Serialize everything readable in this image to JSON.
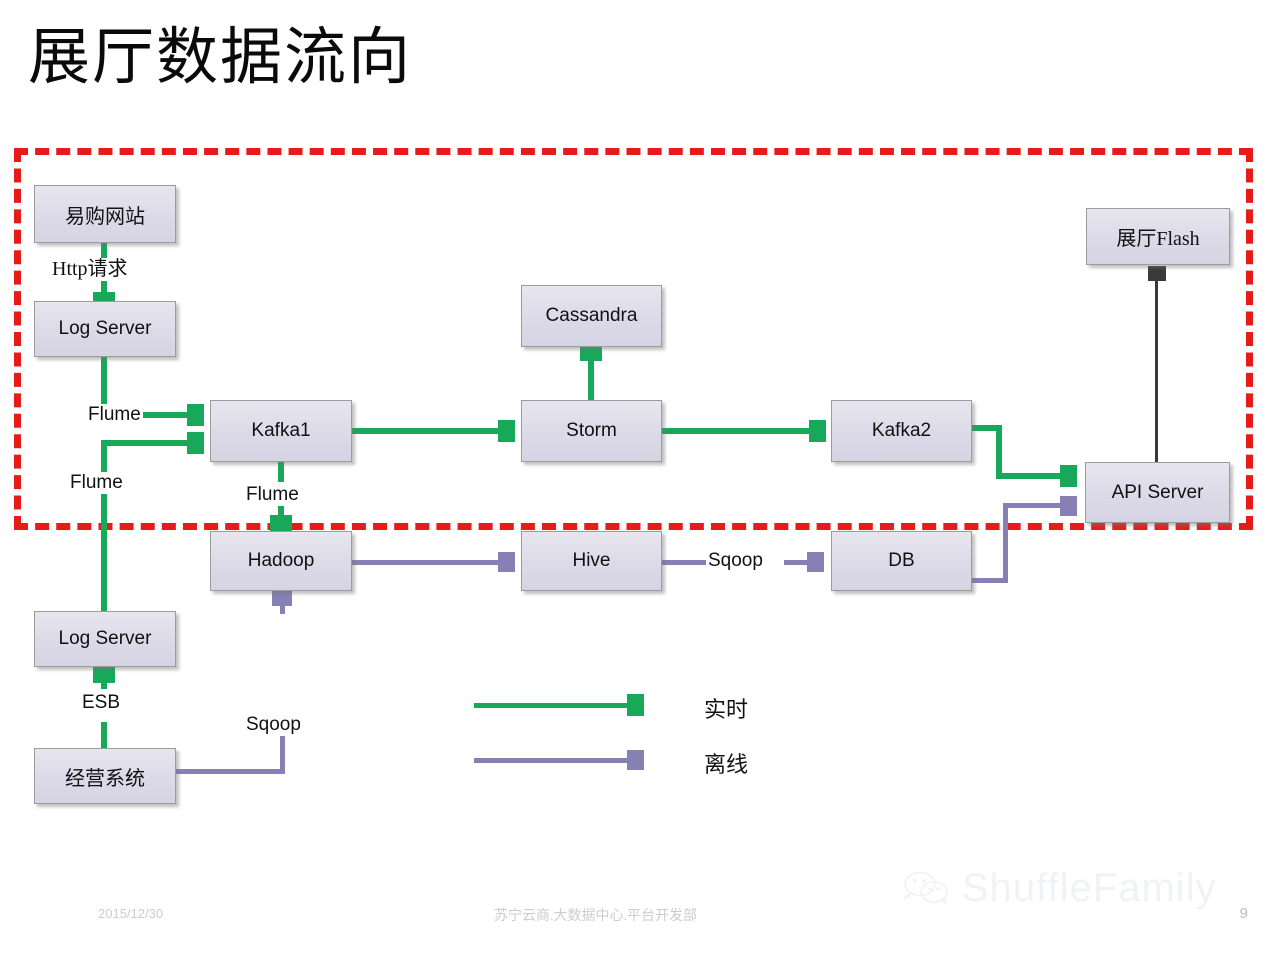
{
  "slide": {
    "title": "展厅数据流向",
    "page_number": "9"
  },
  "zone": {
    "name": "realtime-zone",
    "border_color": "#e81b1b",
    "style": "dashed"
  },
  "nodes": [
    {
      "id": "yigou",
      "label": "易购网站"
    },
    {
      "id": "log-server-1",
      "label": "Log Server"
    },
    {
      "id": "kafka1",
      "label": "Kafka1"
    },
    {
      "id": "cassandra",
      "label": "Cassandra"
    },
    {
      "id": "storm",
      "label": "Storm"
    },
    {
      "id": "kafka2",
      "label": "Kafka2"
    },
    {
      "id": "flash",
      "label": "展厅Flash"
    },
    {
      "id": "api-server",
      "label": "API Server"
    },
    {
      "id": "hadoop",
      "label": "Hadoop"
    },
    {
      "id": "hive",
      "label": "Hive"
    },
    {
      "id": "db",
      "label": "DB"
    },
    {
      "id": "log-server-2",
      "label": "Log Server"
    },
    {
      "id": "jingying",
      "label": "经营系统"
    }
  ],
  "edge_labels": {
    "http_request": "Http请求",
    "flume_1": "Flume",
    "flume_2": "Flume",
    "flume_3": "Flume",
    "esb": "ESB",
    "sqoop_1": "Sqoop",
    "sqoop_2": "Sqoop"
  },
  "legend": {
    "items": [
      {
        "label": "实时",
        "color": "#17a85a"
      },
      {
        "label": "离线",
        "color": "#8680b4"
      }
    ]
  },
  "footer": {
    "date": "2015/12/30",
    "org": "苏宁云商.大数据中心.平台开发部"
  },
  "watermark": {
    "text": "ShuffleFamily",
    "icon": "wechat-icon"
  },
  "chart_data": {
    "type": "diagram",
    "title": "展厅数据流向",
    "nodes": [
      "易购网站",
      "Log Server",
      "Kafka1",
      "Cassandra",
      "Storm",
      "Kafka2",
      "展厅Flash",
      "API Server",
      "Hadoop",
      "Hive",
      "DB",
      "Log Server",
      "经营系统"
    ],
    "edges": [
      {
        "from": "易购网站",
        "to": "Log Server (top)",
        "label": "Http请求",
        "kind": "realtime"
      },
      {
        "from": "Log Server (top)",
        "to": "Kafka1",
        "label": "Flume",
        "kind": "realtime"
      },
      {
        "from": "Log Server (bottom)",
        "to": "Kafka1",
        "label": "Flume",
        "kind": "realtime"
      },
      {
        "from": "Kafka1",
        "to": "Hadoop",
        "label": "Flume",
        "kind": "realtime"
      },
      {
        "from": "Kafka1",
        "to": "Storm",
        "label": "",
        "kind": "realtime"
      },
      {
        "from": "Storm",
        "to": "Cassandra",
        "label": "",
        "kind": "realtime"
      },
      {
        "from": "Storm",
        "to": "Kafka2",
        "label": "",
        "kind": "realtime"
      },
      {
        "from": "Kafka2",
        "to": "API Server",
        "label": "",
        "kind": "realtime"
      },
      {
        "from": "API Server",
        "to": "展厅Flash",
        "label": "",
        "kind": "serve"
      },
      {
        "from": "经营系统",
        "to": "Log Server (bottom)",
        "label": "ESB",
        "kind": "realtime"
      },
      {
        "from": "经营系统",
        "to": "Hadoop",
        "label": "Sqoop",
        "kind": "offline"
      },
      {
        "from": "Hadoop",
        "to": "Hive",
        "label": "",
        "kind": "offline"
      },
      {
        "from": "Hive",
        "to": "DB",
        "label": "Sqoop",
        "kind": "offline"
      },
      {
        "from": "DB",
        "to": "API Server",
        "label": "",
        "kind": "offline"
      }
    ],
    "legend": [
      {
        "label": "实时",
        "color": "#17a85a"
      },
      {
        "label": "离线",
        "color": "#8680b4"
      }
    ]
  }
}
